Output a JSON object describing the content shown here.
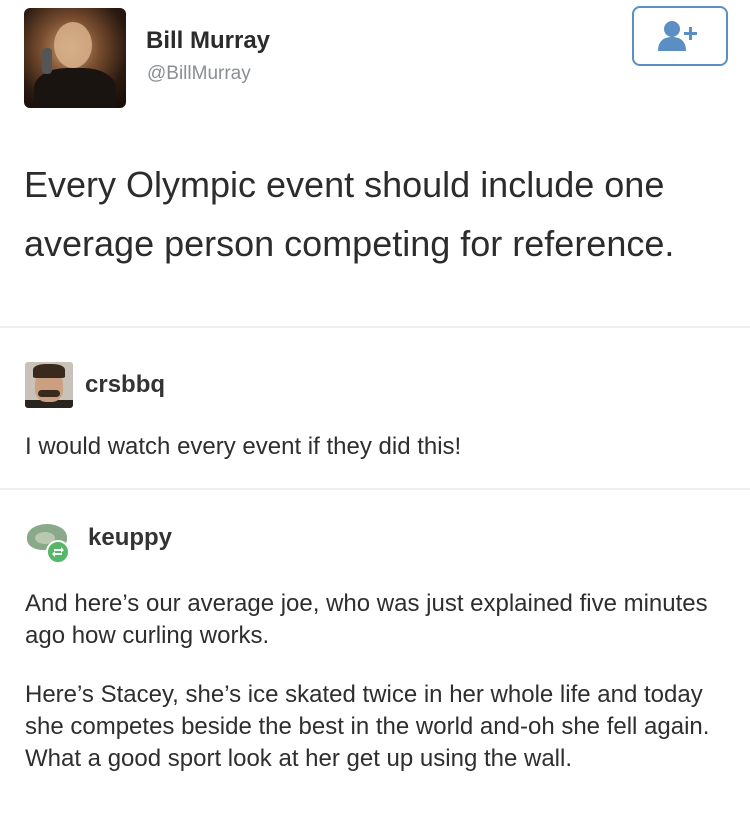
{
  "tweet": {
    "user_name": "Bill Murray",
    "user_handle": "@BillMurray",
    "text": "Every Olympic event should include one average person competing for reference.",
    "follow_icon": "add-user-icon"
  },
  "reblogs": [
    {
      "username": "crsbbq",
      "paragraphs": [
        "I would watch every event if they did this!"
      ]
    },
    {
      "username": "keuppy",
      "reblog_icon": "reblog-icon",
      "paragraphs": [
        "And here’s our average joe, who was just explained five minutes ago how curling works.",
        "Here’s Stacey, she’s ice skated twice in her whole life and today she competes beside the best in the world and-oh she fell again. What a good sport look at her get up using the wall."
      ]
    }
  ],
  "colors": {
    "follow_border": "#5b8fc4",
    "reblog_green": "#56b866",
    "handle_gray": "#8a8f95"
  }
}
